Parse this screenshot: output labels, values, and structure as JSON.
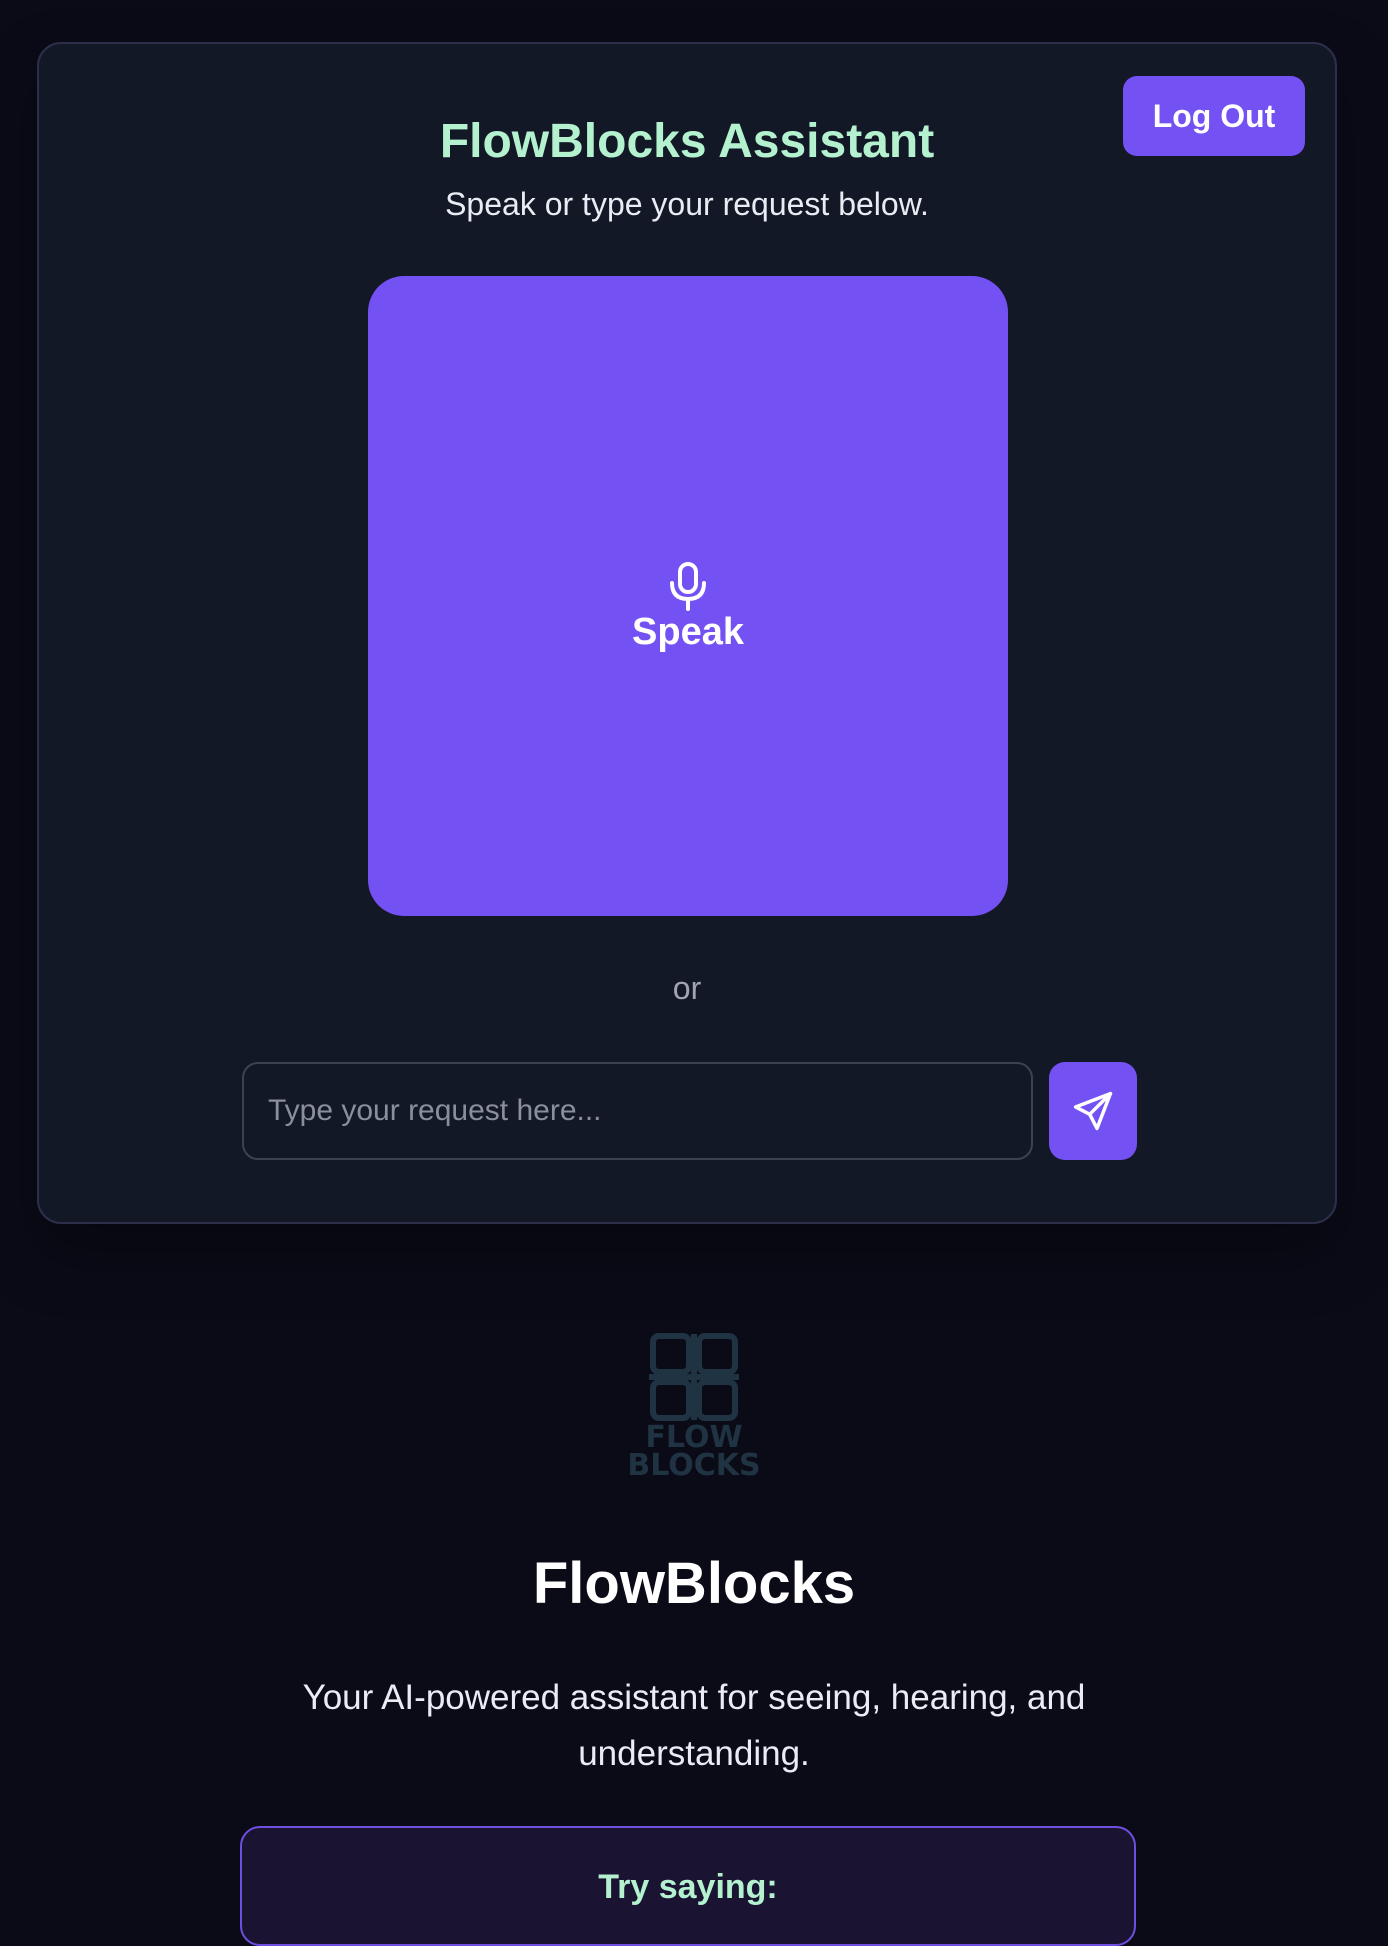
{
  "assistant": {
    "title": "FlowBlocks Assistant",
    "subtitle": "Speak or type your request below.",
    "logout_label": "Log Out",
    "speak_label": "Speak",
    "speak_icon": "microphone-icon",
    "or_label": "or",
    "input_placeholder": "Type your request here...",
    "input_value": "",
    "send_icon": "send-icon"
  },
  "brand": {
    "logo_text_line1": "FLOW",
    "logo_text_line2": "BLOCKS",
    "title": "FlowBlocks",
    "tagline": "Your AI-powered assistant for seeing, hearing, and understanding."
  },
  "suggestions": {
    "title": "Try saying:"
  },
  "colors": {
    "background": "#0b0b18",
    "card": "#131827",
    "accent": "#7451f3",
    "heading_green": "#b4f1cf",
    "logo_muted": "#1f3342"
  }
}
